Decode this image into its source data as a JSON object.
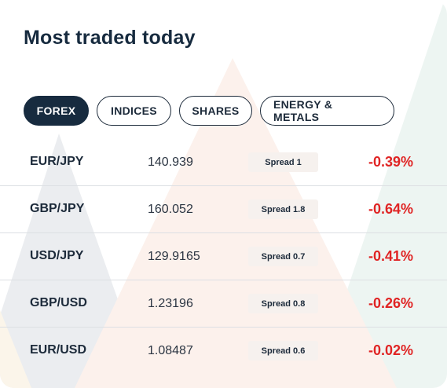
{
  "title": "Most traded today",
  "tabs": [
    {
      "label": "FOREX",
      "active": true
    },
    {
      "label": "INDICES",
      "active": false
    },
    {
      "label": "SHARES",
      "active": false
    },
    {
      "label": "ENERGY & METALS",
      "active": false
    }
  ],
  "rows": [
    {
      "pair": "EUR/JPY",
      "price": "140.939",
      "spread": "Spread 1",
      "change": "-0.39%"
    },
    {
      "pair": "GBP/JPY",
      "price": "160.052",
      "spread": "Spread 1.8",
      "change": "-0.64%"
    },
    {
      "pair": "USD/JPY",
      "price": "129.9165",
      "spread": "Spread 0.7",
      "change": "-0.41%"
    },
    {
      "pair": "GBP/USD",
      "price": "1.23196",
      "spread": "Spread 0.8",
      "change": "-0.26%"
    },
    {
      "pair": "EUR/USD",
      "price": "1.08487",
      "spread": "Spread 0.6",
      "change": "-0.02%"
    }
  ],
  "colors": {
    "navy": "#172b3f",
    "negative": "#e02424",
    "spread_bg": "#f6f1ee",
    "divider": "#dcdfe3"
  }
}
